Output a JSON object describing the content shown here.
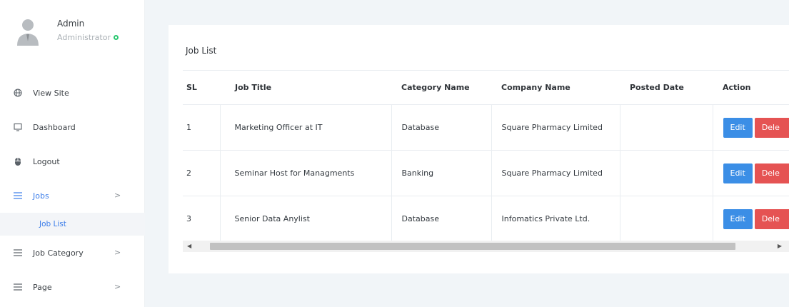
{
  "user": {
    "name": "Admin",
    "role": "Administrator"
  },
  "nav": {
    "items": [
      {
        "label": "View Site",
        "icon": "globe-icon"
      },
      {
        "label": "Dashboard",
        "icon": "monitor-icon"
      },
      {
        "label": "Logout",
        "icon": "mouse-icon"
      },
      {
        "label": "Jobs",
        "icon": "list-icon",
        "chevron": ">"
      },
      {
        "label": "Job Category",
        "icon": "list-icon",
        "chevron": ">"
      },
      {
        "label": "Page",
        "icon": "list-icon",
        "chevron": ">"
      }
    ],
    "sub_item": "Job List"
  },
  "card": {
    "title": "Job List"
  },
  "table": {
    "headers": [
      "SL",
      "Job Title",
      "Category Name",
      "Company Name",
      "Posted Date",
      "Action"
    ],
    "rows": [
      {
        "sl": "1",
        "title": "Marketing Officer at IT",
        "category": "Database",
        "company": "Square Pharmacy Limited",
        "posted": ""
      },
      {
        "sl": "2",
        "title": "Seminar Host for Managments",
        "category": "Banking",
        "company": "Square Pharmacy Limited",
        "posted": ""
      },
      {
        "sl": "3",
        "title": "Senior Data Anylist",
        "category": "Database",
        "company": "Infomatics Private Ltd.",
        "posted": ""
      }
    ],
    "edit_label": "Edit",
    "delete_label": "Dele"
  },
  "colors": {
    "accent": "#3b7de9",
    "edit": "#3b8ee6",
    "delete": "#e55353",
    "online": "#28c76f"
  }
}
